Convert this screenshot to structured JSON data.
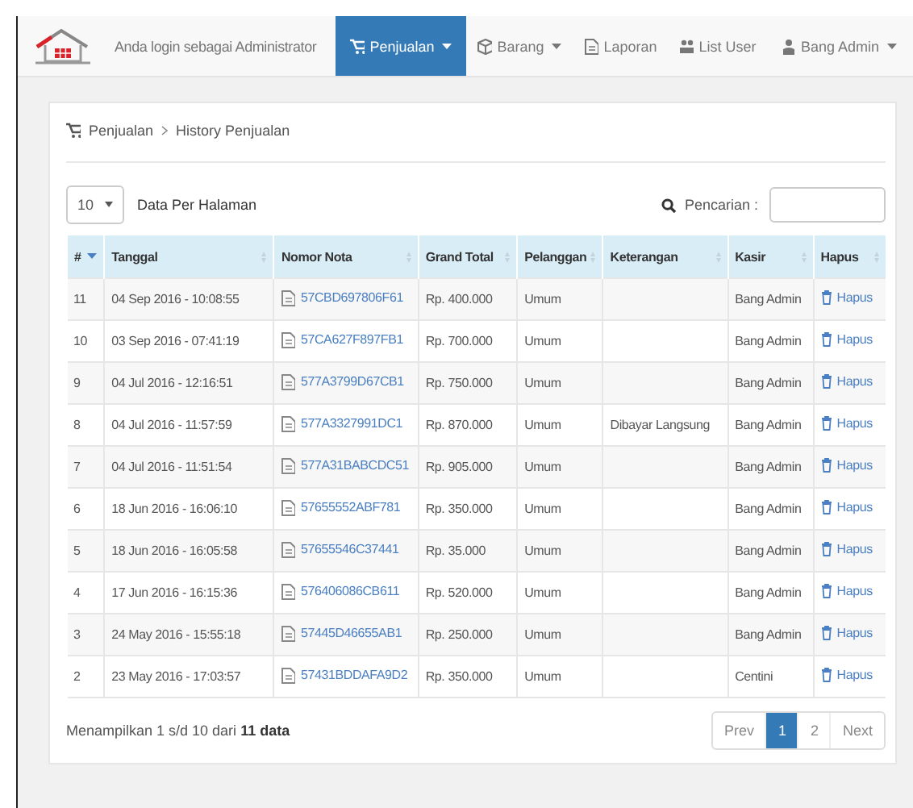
{
  "navbar": {
    "login_text": "Anda login sebagai Administrator",
    "menu": [
      {
        "label": "Penjualan",
        "selected": true,
        "dropdown": true
      },
      {
        "label": "Barang",
        "selected": false,
        "dropdown": true
      },
      {
        "label": "Laporan",
        "selected": false,
        "dropdown": false
      },
      {
        "label": "List User",
        "selected": false,
        "dropdown": false
      }
    ],
    "user": {
      "label": "Bang Admin",
      "dropdown": true
    }
  },
  "breadcrumb": [
    "Penjualan",
    "History Penjualan"
  ],
  "page_size": {
    "value": "10",
    "label": "Data Per Halaman"
  },
  "search": {
    "label": "Pencarian :"
  },
  "table": {
    "columns": [
      {
        "label": "#",
        "sorted": true
      },
      {
        "label": "Tanggal",
        "sorted": false
      },
      {
        "label": "Nomor Nota",
        "sorted": false
      },
      {
        "label": "Grand Total",
        "sorted": false
      },
      {
        "label": "Pelanggan",
        "sorted": false
      },
      {
        "label": "Keterangan",
        "sorted": false
      },
      {
        "label": "Kasir",
        "sorted": false
      },
      {
        "label": "Hapus",
        "sorted": false
      }
    ],
    "rows": [
      {
        "no": "11",
        "tanggal": "04 Sep 2016 - 10:08:55",
        "nota": "57CBD697806F61",
        "total": "Rp. 400.000",
        "pelanggan": "Umum",
        "keterangan": "",
        "kasir": "Bang Admin",
        "hapus": "Hapus"
      },
      {
        "no": "10",
        "tanggal": "03 Sep 2016 - 07:41:19",
        "nota": "57CA627F897FB1",
        "total": "Rp. 700.000",
        "pelanggan": "Umum",
        "keterangan": "",
        "kasir": "Bang Admin",
        "hapus": "Hapus"
      },
      {
        "no": "9",
        "tanggal": "04 Jul 2016 - 12:16:51",
        "nota": "577A3799D67CB1",
        "total": "Rp. 750.000",
        "pelanggan": "Umum",
        "keterangan": "",
        "kasir": "Bang Admin",
        "hapus": "Hapus"
      },
      {
        "no": "8",
        "tanggal": "04 Jul 2016 - 11:57:59",
        "nota": "577A3327991DC1",
        "total": "Rp. 870.000",
        "pelanggan": "Umum",
        "keterangan": "Dibayar Langsung",
        "kasir": "Bang Admin",
        "hapus": "Hapus"
      },
      {
        "no": "7",
        "tanggal": "04 Jul 2016 - 11:51:54",
        "nota": "577A31BABCDC51",
        "total": "Rp. 905.000",
        "pelanggan": "Umum",
        "keterangan": "",
        "kasir": "Bang Admin",
        "hapus": "Hapus"
      },
      {
        "no": "6",
        "tanggal": "18 Jun 2016 - 16:06:10",
        "nota": "57655552ABF781",
        "total": "Rp. 350.000",
        "pelanggan": "Umum",
        "keterangan": "",
        "kasir": "Bang Admin",
        "hapus": "Hapus"
      },
      {
        "no": "5",
        "tanggal": "18 Jun 2016 - 16:05:58",
        "nota": "57655546C37441",
        "total": "Rp. 35.000",
        "pelanggan": "Umum",
        "keterangan": "",
        "kasir": "Bang Admin",
        "hapus": "Hapus"
      },
      {
        "no": "4",
        "tanggal": "17 Jun 2016 - 16:15:36",
        "nota": "576406086CB611",
        "total": "Rp. 520.000",
        "pelanggan": "Umum",
        "keterangan": "",
        "kasir": "Bang Admin",
        "hapus": "Hapus"
      },
      {
        "no": "3",
        "tanggal": "24 May 2016 - 15:55:18",
        "nota": "57445D46655AB1",
        "total": "Rp. 250.000",
        "pelanggan": "Umum",
        "keterangan": "",
        "kasir": "Bang Admin",
        "hapus": "Hapus"
      },
      {
        "no": "2",
        "tanggal": "23 May 2016 - 17:03:57",
        "nota": "57431BDDAFA9D2",
        "total": "Rp. 350.000",
        "pelanggan": "Umum",
        "keterangan": "",
        "kasir": "Centini",
        "hapus": "Hapus"
      }
    ]
  },
  "info": "Menampilkan 1 s/d 10 dari **11 data**",
  "pagination": [
    {
      "label": "Prev",
      "selected": false
    },
    {
      "label": "1",
      "selected": true
    },
    {
      "label": "2",
      "selected": false
    },
    {
      "label": "Next",
      "selected": false
    }
  ]
}
